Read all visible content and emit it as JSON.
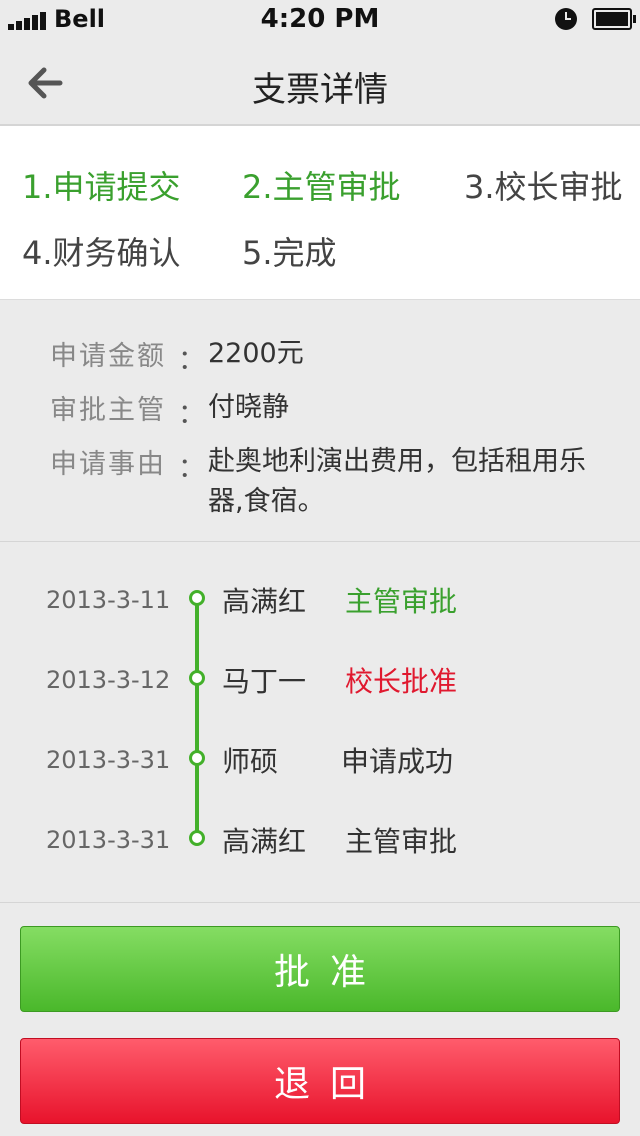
{
  "status_bar": {
    "carrier": "Bell",
    "time": "4:20 PM",
    "battery_icon": "battery-icon",
    "alarm_icon": "clock-icon"
  },
  "nav": {
    "title": "支票详情",
    "back_icon": "arrow-left-icon"
  },
  "steps": [
    {
      "label": "1.申请提交",
      "state": "done"
    },
    {
      "label": "2.主管审批",
      "state": "done"
    },
    {
      "label": "3.校长审批",
      "state": "todo"
    },
    {
      "label": "4.财务确认",
      "state": "todo"
    },
    {
      "label": "5.完成",
      "state": "todo"
    }
  ],
  "info": {
    "colon": "：",
    "amount": {
      "label": "申请金额",
      "value": "2200元"
    },
    "supervisor": {
      "label": "审批主管",
      "value": "付晓静"
    },
    "reason": {
      "label": "申请事由",
      "value": "赴奥地利演出费用，包括租用乐器,食宿。"
    }
  },
  "timeline": [
    {
      "date": "2013-3-11",
      "person": "高满红",
      "action": "主管审批",
      "color": "#3aa02e"
    },
    {
      "date": "2013-3-12",
      "person": "马丁一",
      "action": "校长批准",
      "color": "#e0192f"
    },
    {
      "date": "2013-3-31",
      "person": "师硕",
      "action": "申请成功",
      "color": "#333333"
    },
    {
      "date": "2013-3-31",
      "person": "高满红",
      "action": "主管审批",
      "color": "#333333"
    }
  ],
  "buttons": {
    "approve": "批准",
    "reject": "退回"
  },
  "colors": {
    "accent_green": "#43b02a",
    "reject_red": "#e8132c"
  }
}
